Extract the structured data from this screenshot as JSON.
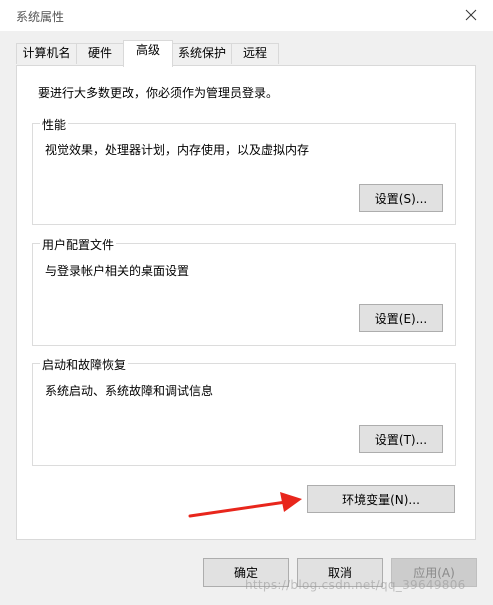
{
  "window": {
    "title": "系统属性"
  },
  "tabs": [
    {
      "label": "计算机名"
    },
    {
      "label": "硬件"
    },
    {
      "label": "高级"
    },
    {
      "label": "系统保护"
    },
    {
      "label": "远程"
    }
  ],
  "notice": "要进行大多数更改，你必须作为管理员登录。",
  "groups": {
    "performance": {
      "title": "性能",
      "desc": "视觉效果，处理器计划，内存使用，以及虚拟内存",
      "button": "设置(S)..."
    },
    "profiles": {
      "title": "用户配置文件",
      "desc": "与登录帐户相关的桌面设置",
      "button": "设置(E)..."
    },
    "startup": {
      "title": "启动和故障恢复",
      "desc": "系统启动、系统故障和调试信息",
      "button": "设置(T)..."
    }
  },
  "env_button": "环境变量(N)...",
  "footer": {
    "ok": "确定",
    "cancel": "取消",
    "apply": "应用(A)"
  },
  "watermark": "https://blog.csdn.net/qq_39649806",
  "colors": {
    "arrow": "#e8261c",
    "panel_border": "#d9d9d9",
    "button_face": "#e1e1e1"
  }
}
